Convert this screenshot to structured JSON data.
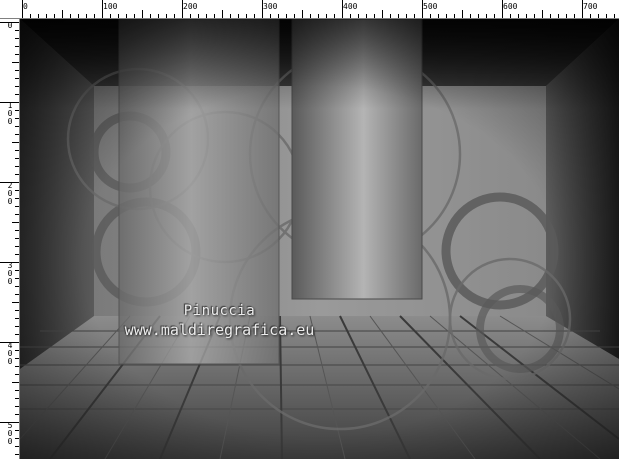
{
  "ruler": {
    "top_labels": [
      "0",
      "100",
      "200",
      "300",
      "400",
      "500",
      "600",
      "700"
    ],
    "left_labels": [
      "0",
      "100",
      "200",
      "300",
      "400",
      "500"
    ]
  },
  "watermark": {
    "line1": "Pinuccia",
    "line2": "www.maldiregrafica.eu"
  }
}
